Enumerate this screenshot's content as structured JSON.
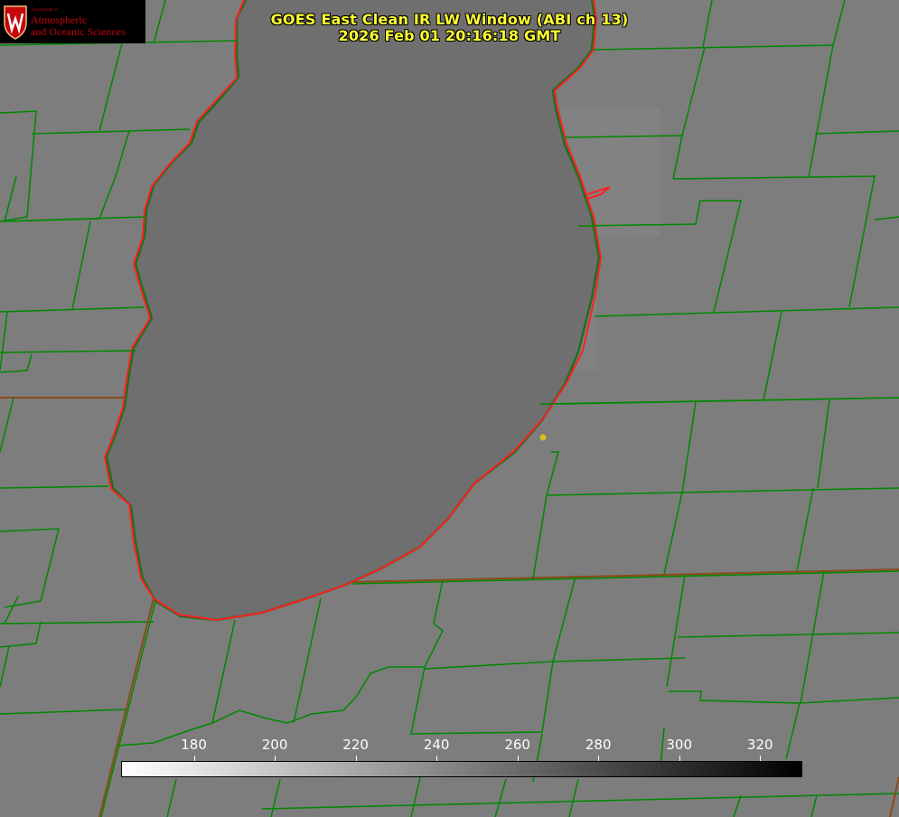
{
  "title": {
    "line1": "GOES East Clean IR LW Window (ABI ch 13)",
    "line2": "2026 Feb 01 20:16:18 GMT"
  },
  "logo": {
    "department": "Department of",
    "line1": "Atmospheric",
    "line2": "and Oceanic Sciences",
    "crest_letter": "W"
  },
  "colorbar": {
    "min": 162,
    "max": 330,
    "ticks": [
      "180",
      "200",
      "220",
      "240",
      "260",
      "280",
      "300",
      "320"
    ],
    "tick_values": [
      180,
      200,
      220,
      240,
      260,
      280,
      300,
      320
    ]
  },
  "colors": {
    "background": "#7c7c7c",
    "lake": "#6e6e6e",
    "county_lines": "#008800",
    "shoreline": "#ff2020",
    "title_text": "#ffff33",
    "marker": "#d4c21a"
  }
}
